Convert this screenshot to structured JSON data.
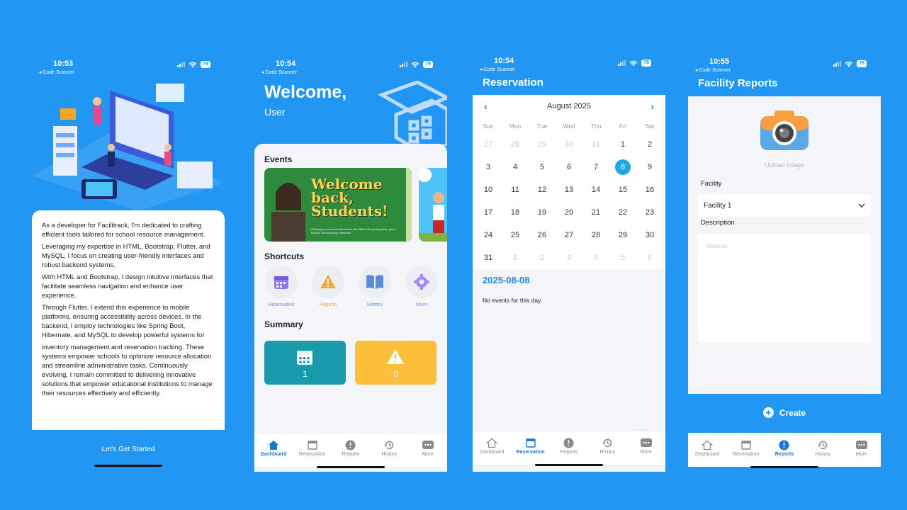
{
  "status_bar": {
    "carrier": "◂ Code Scanner"
  },
  "phones": {
    "p1": {
      "time": "10:53",
      "battery": "79"
    },
    "p2": {
      "time": "10:54",
      "battery": "79"
    },
    "p3": {
      "time": "10:54",
      "battery": "78"
    },
    "p4": {
      "time": "10:55",
      "battery": "78"
    }
  },
  "onboarding": {
    "paragraphs": [
      "As a developer for Facilitrack, I'm dedicated to crafting efficient tools tailored for school resource management.",
      "Leveraging my expertise in HTML, Bootstrap, Flutter, and MySQL, I focus on creating user-friendly interfaces and robust backend systems.",
      "With HTML and Bootstrap, I design intuitive interfaces that facilitate seamless navigation and enhance user experience.",
      "Through Flutter, I extend this experience to mobile platforms, ensuring accessibility across devices. In the backend, I employ technologies like Spring Boot, Hibernate, and MySQL to develop powerful systems for",
      "inventory management and reservation tracking. These systems empower schools to optimize resource allocation and streamline administrative tasks. Continuously evolving, I remain committed to delivering innovative solutions that empower educational institutions to manage their resources effectively and efficiently."
    ],
    "start_label": "Let's Get Started"
  },
  "dashboard": {
    "welcome": "Welcome,",
    "user": "User",
    "events_title": "Events",
    "banner_line1": "Welcome",
    "banner_line2": "back,",
    "banner_line3": "Students!",
    "banner_caption": "Wishing you a successful school year filled with good grades, great friends, and amazing memories.",
    "shortcuts_title": "Shortcuts",
    "shortcuts": [
      {
        "label": "Reservation",
        "color": "#8b7cf6"
      },
      {
        "label": "Reports",
        "color": "#f0a93a"
      },
      {
        "label": "History",
        "color": "#5b8dd6"
      },
      {
        "label": "More",
        "color": "#9b8cf6"
      }
    ],
    "summary_title": "Summary",
    "summary": [
      {
        "value": "1",
        "color": "#1a9aad"
      },
      {
        "value": "0",
        "color": "#fbbf3a"
      }
    ]
  },
  "tabs": [
    "Dashboard",
    "Reservation",
    "Reports",
    "History",
    "More"
  ],
  "reservation": {
    "title": "Reservation",
    "month": "August 2025",
    "days_of_week": [
      "Sun",
      "Mon",
      "Tue",
      "Wed",
      "Thu",
      "Fri",
      "Sat"
    ],
    "selected_date": "2025-08-08",
    "no_events": "No events for this day."
  },
  "reports": {
    "title": "Facility Reports",
    "upload_label": "Upload Image",
    "facility_label": "Facility",
    "facility_value": "Facility 1",
    "description_label": "Description",
    "description_placeholder": "Reason",
    "create_label": "Create"
  },
  "colors": {
    "background": "#2196f3",
    "accent": "#1e88e5",
    "selected_day": "#1ea7e4"
  }
}
